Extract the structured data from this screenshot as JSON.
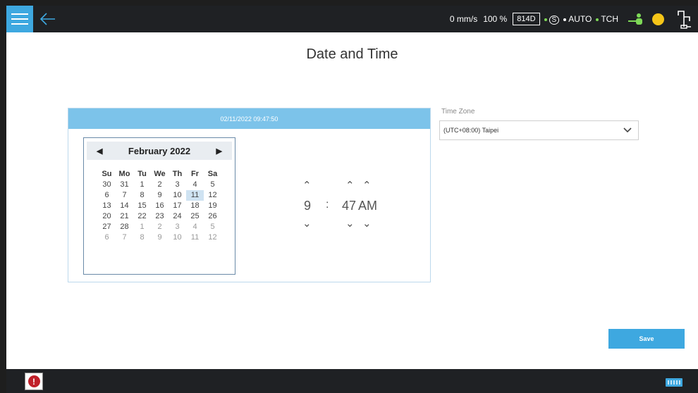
{
  "header": {
    "speed": "0 mm/s",
    "override": "100 %",
    "robot_id": "814D",
    "mode_auto": "AUTO",
    "mode_tch": "TCH",
    "accent_color": "#3ea8e0",
    "status_color": "#f5c518"
  },
  "page": {
    "title": "Date and Time"
  },
  "datetime": {
    "current": "02/11/2022 09:47:50"
  },
  "calendar": {
    "month_label": "February 2022",
    "weekdays": [
      "Su",
      "Mo",
      "Tu",
      "We",
      "Th",
      "Fr",
      "Sa"
    ],
    "weeks": [
      [
        "30",
        "31",
        "1",
        "2",
        "3",
        "4",
        "5"
      ],
      [
        "6",
        "7",
        "8",
        "9",
        "10",
        "11",
        "12"
      ],
      [
        "13",
        "14",
        "15",
        "16",
        "17",
        "18",
        "19"
      ],
      [
        "20",
        "21",
        "22",
        "23",
        "24",
        "25",
        "26"
      ],
      [
        "27",
        "28",
        "1",
        "2",
        "3",
        "4",
        "5"
      ],
      [
        "6",
        "7",
        "8",
        "9",
        "10",
        "11",
        "12"
      ]
    ],
    "selected": "11"
  },
  "time": {
    "hour": "9",
    "separator": ":",
    "minute": "47",
    "ampm": "AM"
  },
  "timezone": {
    "label": "Time Zone",
    "value": "(UTC+08:00) Taipei"
  },
  "actions": {
    "save_label": "Save"
  }
}
